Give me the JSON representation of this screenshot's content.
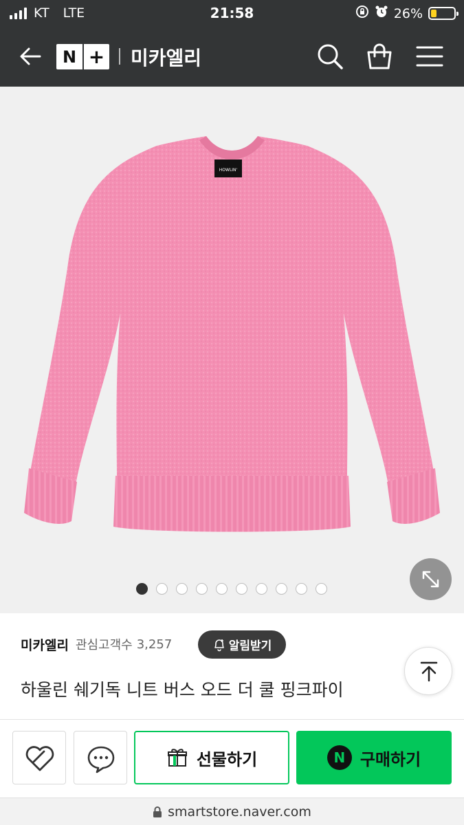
{
  "status_bar": {
    "carrier": "KT",
    "network": "LTE",
    "time": "21:58",
    "battery": "26%",
    "battery_level": 0.26
  },
  "header": {
    "brand_logo_n": "N",
    "brand_logo_plus": "+",
    "store_name": "미카엘리"
  },
  "gallery": {
    "label_text": "HOWLIN'",
    "image_count": 10,
    "active_index": 0
  },
  "store": {
    "name": "미카엘리",
    "fans_label": "관심고객수",
    "fans_count": "3,257",
    "alarm_label": "알림받기"
  },
  "product": {
    "title": "하울린 쉐기독 니트 버스 오드 더 쿨 핑크파이"
  },
  "actions": {
    "gift_label": "선물하기",
    "buy_label": "구매하기",
    "npay_mark": "N"
  },
  "url": {
    "domain": "smartstore.naver.com"
  },
  "colors": {
    "header_bg": "#333536",
    "accent_green": "#03c75a",
    "sweater_pink": "#f48fb3"
  }
}
